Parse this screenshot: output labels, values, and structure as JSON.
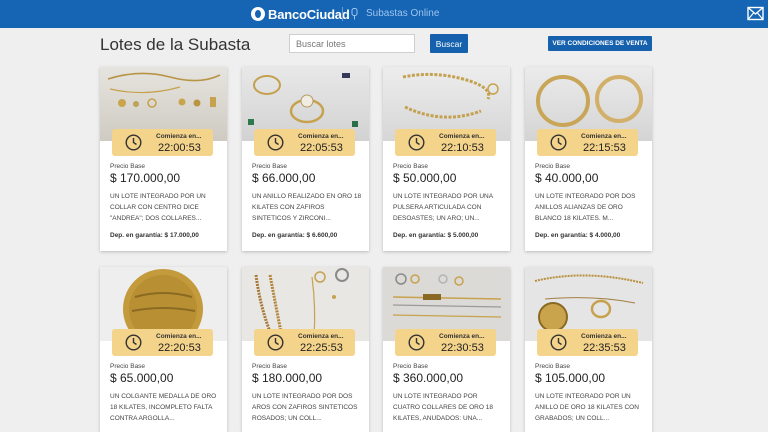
{
  "header": {
    "brand": "BancoCiudad",
    "section": "Subastas Online",
    "colors": {
      "bar": "#1565b4",
      "accent": "#f4d38a",
      "button": "#1561ad"
    }
  },
  "toolbar": {
    "title": "Lotes de la Subasta",
    "search_placeholder": "Buscar lotes",
    "search_button": "Buscar",
    "conditions_button": "VER CONDICIONES DE VENTA"
  },
  "cards": [
    {
      "starts_label": "Comienza en...",
      "time": "22:00:53",
      "price_label": "Precio Base",
      "price": "$ 170.000,00",
      "description": "UN LOTE INTEGRADO POR UN COLLAR CON CENTRO DICE \"ANDREA\"; DOS COLLARES...",
      "guarantee": "Dep. en garantía: $ 17.000,00"
    },
    {
      "starts_label": "Comienza en...",
      "time": "22:05:53",
      "price_label": "Precio Base",
      "price": "$ 66.000,00",
      "description": "UN ANILLO REALIZADO EN ORO 18 KILATES CON ZAFIROS SINTETICOS Y ZIRCONI...",
      "guarantee": "Dep. en garantía: $ 6.600,00"
    },
    {
      "starts_label": "Comienza en...",
      "time": "22:10:53",
      "price_label": "Precio Base",
      "price": "$ 50.000,00",
      "description": "UN LOTE INTEGRADO POR UNA PULSERA ARTICULADA CON DESOASTES; UN ARO; UN...",
      "guarantee": "Dep. en garantía: $ 5.000,00"
    },
    {
      "starts_label": "Comienza en...",
      "time": "22:15:53",
      "price_label": "Precio Base",
      "price": "$ 40.000,00",
      "description": "UN LOTE INTEGRADO POR DOS ANILLOS ALIANZAS DE ORO BLANCO 18 KILATES. M...",
      "guarantee": "Dep. en garantía: $ 4.000,00"
    },
    {
      "starts_label": "Comienza en...",
      "time": "22:20:53",
      "price_label": "Precio Base",
      "price": "$ 65.000,00",
      "description": "UN COLGANTE MEDALLA DE ORO 18 KILATES, INCOMPLETO FALTA CONTRA ARGOLLA...",
      "guarantee": ""
    },
    {
      "starts_label": "Comienza en...",
      "time": "22:25:53",
      "price_label": "Precio Base",
      "price": "$ 180.000,00",
      "description": "UN LOTE INTEGRADO POR DOS AROS CON ZAFIROS SINTETICOS ROSADOS; UN COLL...",
      "guarantee": ""
    },
    {
      "starts_label": "Comienza en...",
      "time": "22:30:53",
      "price_label": "Precio Base",
      "price": "$ 360.000,00",
      "description": "UN LOTE INTEGRADO POR CUATRO COLLARES DE ORO 18 KILATES, ANUDADOS: UNA...",
      "guarantee": ""
    },
    {
      "starts_label": "Comienza en...",
      "time": "22:35:53",
      "price_label": "Precio Base",
      "price": "$ 105.000,00",
      "description": "UN LOTE INTEGRADO POR UN ANILLO DE ORO 18 KILATES CON GRABADOS; UN COLL...",
      "guarantee": ""
    }
  ]
}
